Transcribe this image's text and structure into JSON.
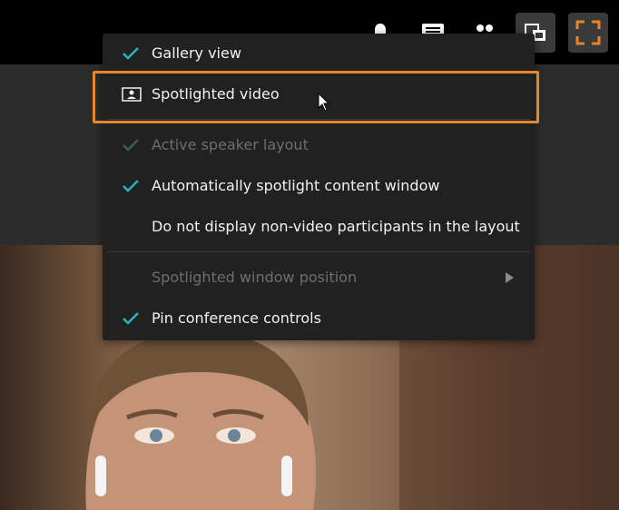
{
  "toolbar": {
    "buttons": [
      {
        "icon": "bell-icon"
      },
      {
        "icon": "chat-icon"
      },
      {
        "icon": "participants-icon"
      },
      {
        "icon": "layout-switch-icon"
      },
      {
        "icon": "fullscreen-icon"
      }
    ],
    "accent_color": "#e8842a"
  },
  "menu": {
    "items": [
      {
        "label": "Gallery view",
        "checked": true,
        "disabled": false
      },
      {
        "label": "Spotlighted video",
        "checked": false,
        "disabled": false,
        "icon": "spotlight-video-icon"
      },
      {
        "label": "Active speaker layout",
        "checked": true,
        "disabled": true
      },
      {
        "label": "Automatically spotlight content window",
        "checked": true,
        "disabled": false
      },
      {
        "label": "Do not display non-video participants in the layout",
        "checked": false,
        "disabled": false
      },
      {
        "label": "Spotlighted window position",
        "checked": false,
        "disabled": true,
        "submenu": true
      },
      {
        "label": "Pin conference controls",
        "checked": true,
        "disabled": false
      }
    ],
    "check_color": "#2bb3c0"
  }
}
